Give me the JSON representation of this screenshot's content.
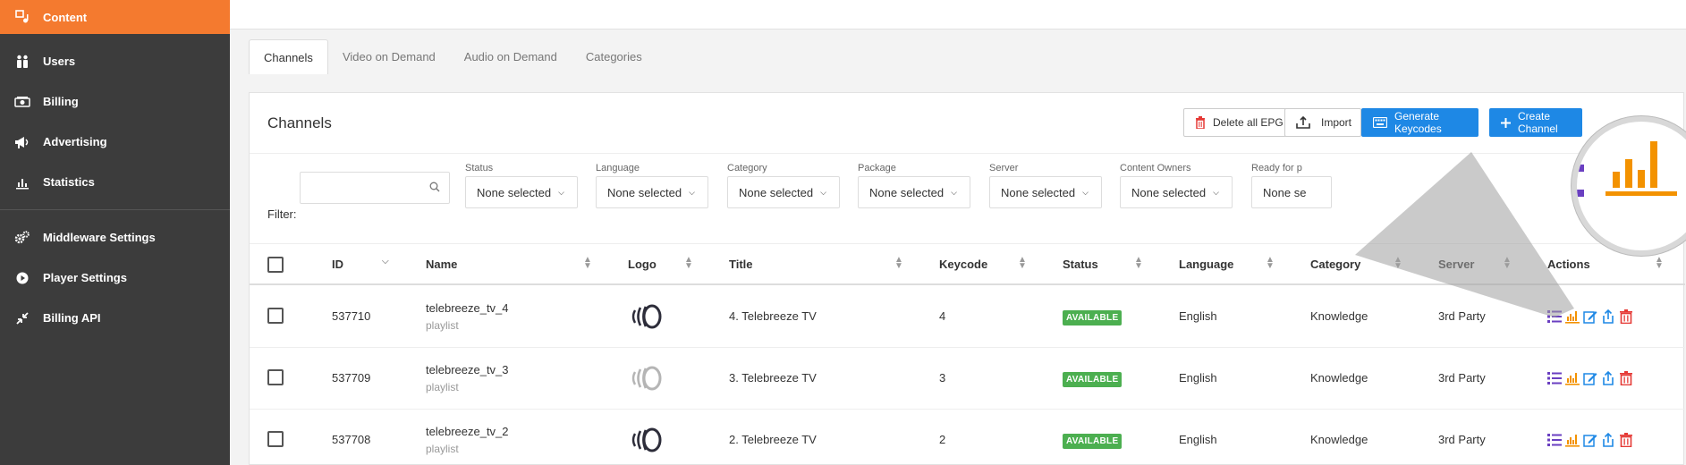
{
  "sidebar": {
    "items": [
      {
        "label": "Content",
        "icon": "content-icon",
        "active": true
      },
      {
        "label": "Users",
        "icon": "users-icon"
      },
      {
        "label": "Billing",
        "icon": "billing-icon"
      },
      {
        "label": "Advertising",
        "icon": "megaphone-icon"
      },
      {
        "label": "Statistics",
        "icon": "bar-chart-icon"
      },
      {
        "label": "Middleware Settings",
        "icon": "gears-icon"
      },
      {
        "label": "Player Settings",
        "icon": "play-circle-icon"
      },
      {
        "label": "Billing API",
        "icon": "compress-arrows-icon"
      }
    ]
  },
  "tabs": [
    {
      "label": "Channels",
      "active": true
    },
    {
      "label": "Video on Demand"
    },
    {
      "label": "Audio on Demand"
    },
    {
      "label": "Categories"
    }
  ],
  "panel": {
    "title": "Channels",
    "buttons": {
      "delete_epg": "Delete all EPG",
      "import": "Import",
      "generate": "Generate Keycodes",
      "create": "Create Channel"
    }
  },
  "filters": {
    "label": "Filter:",
    "search_value": "",
    "groups": [
      {
        "label": "Status",
        "value": "None selected"
      },
      {
        "label": "Language",
        "value": "None selected"
      },
      {
        "label": "Category",
        "value": "None selected"
      },
      {
        "label": "Package",
        "value": "None selected"
      },
      {
        "label": "Server",
        "value": "None selected"
      },
      {
        "label": "Content Owners",
        "value": "None selected"
      },
      {
        "label": "Ready for p",
        "value": "None se"
      }
    ]
  },
  "table": {
    "headers": {
      "id": "ID",
      "name": "Name",
      "logo": "Logo",
      "title": "Title",
      "keycode": "Keycode",
      "status": "Status",
      "language": "Language",
      "category": "Category",
      "server": "Server",
      "actions": "Actions"
    },
    "rows": [
      {
        "id": "537710",
        "name": "telebreeze_tv_4",
        "type": "playlist",
        "title": "4. Telebreeze TV",
        "keycode": "4",
        "status": "AVAILABLE",
        "language": "English",
        "category": "Knowledge",
        "server": "3rd Party",
        "logo_faded": false
      },
      {
        "id": "537709",
        "name": "telebreeze_tv_3",
        "type": "playlist",
        "title": "3. Telebreeze TV",
        "keycode": "3",
        "status": "AVAILABLE",
        "language": "English",
        "category": "Knowledge",
        "server": "3rd Party",
        "logo_faded": true
      },
      {
        "id": "537708",
        "name": "telebreeze_tv_2",
        "type": "playlist",
        "title": "2. Telebreeze TV",
        "keycode": "2",
        "status": "AVAILABLE",
        "language": "English",
        "category": "Knowledge",
        "server": "3rd Party",
        "logo_faded": false
      }
    ]
  },
  "colors": {
    "accent": "#f47a2f",
    "sidebar_bg": "#3c3c3c",
    "primary_button": "#1e88e5",
    "badge_available": "#4caf50",
    "action_list": "#6a3fc1",
    "action_stats": "#f39200",
    "action_edit": "#1e88e5",
    "action_delete": "#e53935"
  }
}
